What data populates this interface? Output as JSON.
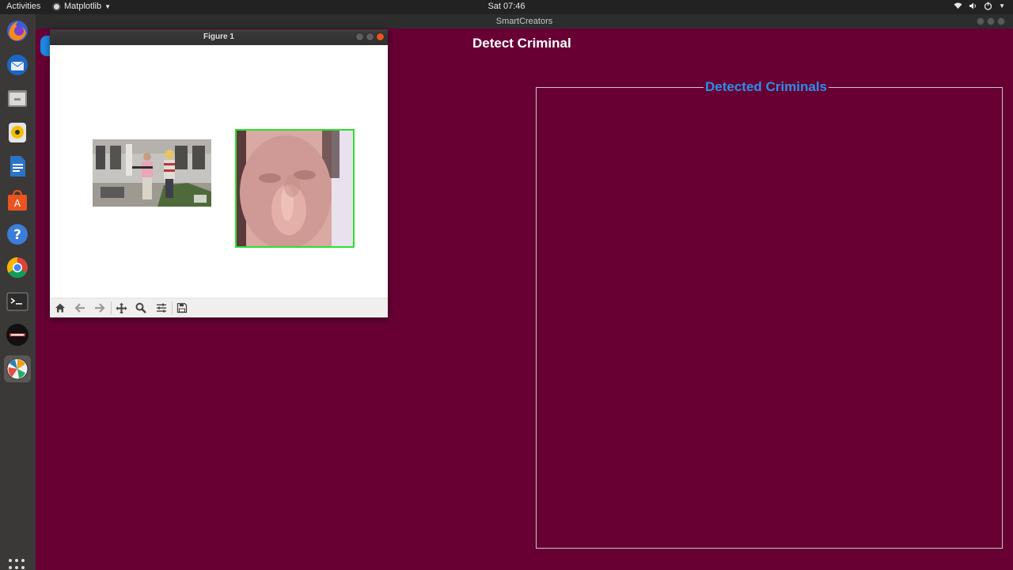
{
  "topbar": {
    "activities_label": "Activities",
    "app_menu_label": "Matplotlib",
    "clock": "Sat 07:46",
    "status_icons": [
      "wifi-icon",
      "volume-icon",
      "power-icon"
    ]
  },
  "main_window": {
    "title": "SmartCreators",
    "heading": "Detect Criminal",
    "detected_panel_label": "Detected Criminals"
  },
  "figure_window": {
    "title": "Figure 1",
    "toolbar_icons": [
      "home-icon",
      "back-icon",
      "forward-icon",
      "pan-icon",
      "zoom-icon",
      "configure-subplots-icon",
      "save-icon"
    ]
  },
  "dock": {
    "apps": [
      "firefox-icon",
      "thunderbird-icon",
      "files-icon",
      "rhythmbox-icon",
      "writer-icon",
      "software-center-icon",
      "help-icon",
      "chrome-icon",
      "terminal-icon",
      "smartcreators-logo-icon",
      "matplotlib-icon"
    ]
  },
  "colors": {
    "background": "#680034",
    "accent_label": "#2b8fe8",
    "face_box": "#2de02d"
  }
}
